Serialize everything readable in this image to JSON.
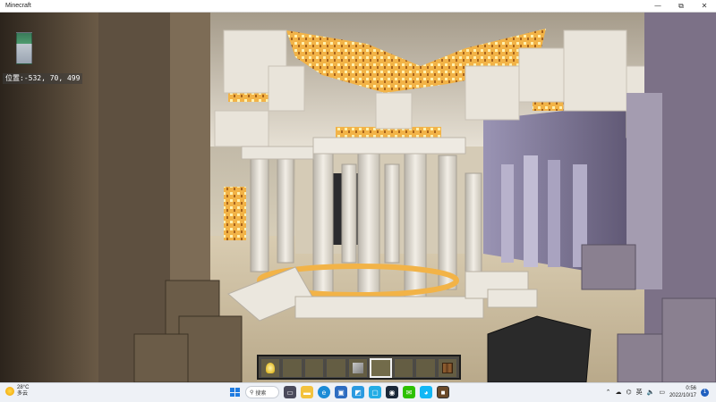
{
  "window": {
    "title": "Minecraft",
    "minimize_glyph": "—",
    "maximize_glyph": "⧉",
    "close_glyph": "✕"
  },
  "hud": {
    "coordinates": "位置:-532, 70, 499",
    "hotbar": {
      "selected_index": 5,
      "slots": [
        {
          "item": "lantern-icon"
        },
        {
          "item": ""
        },
        {
          "item": ""
        },
        {
          "item": ""
        },
        {
          "item": "stone-block-icon"
        },
        {
          "item": ""
        },
        {
          "item": ""
        },
        {
          "item": ""
        },
        {
          "item": "crafting-table-icon"
        }
      ]
    }
  },
  "taskbar": {
    "weather": {
      "temp": "28°C",
      "condition": "多云"
    },
    "search_label": "搜索",
    "apps": [
      "start-icon",
      "search",
      "task-view-icon",
      "file-explorer-icon",
      "edge-icon",
      "store-icon",
      "photos-icon",
      "bilibili-icon",
      "steam-icon",
      "wechat-icon",
      "qq-icon",
      "minecraft-icon"
    ],
    "tray": {
      "ime": "英",
      "time": "0:56",
      "date": "2022/10/17",
      "notification_count": "1"
    }
  },
  "colors": {
    "ambient_light": "#e6dcc6",
    "glowstone": "#f3b84a",
    "quartz": "#e8e4dc",
    "shadow": "#3a3026"
  }
}
